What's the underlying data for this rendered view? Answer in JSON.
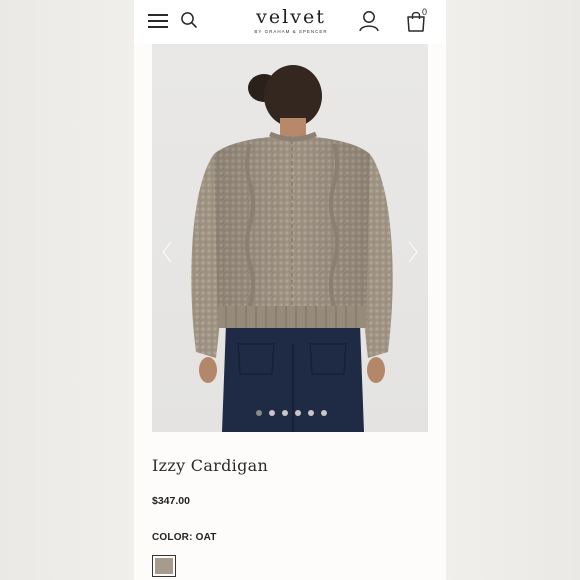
{
  "header": {
    "brand_name": "velvet",
    "brand_tagline": "BY GRAHAM & SPENCER",
    "cart_count": "0",
    "icons": [
      "menu-icon",
      "search-icon",
      "account-icon",
      "shopping-bag-icon"
    ]
  },
  "product": {
    "name": "Izzy Cardigan",
    "price": "$347.00",
    "color_label": "COLOR: OAT",
    "swatch_color": "#a79b8c",
    "image_count": 6,
    "active_image": 0
  },
  "colors": {
    "background": "#efedea",
    "page": "#fdfcfb",
    "text": "#222222"
  }
}
